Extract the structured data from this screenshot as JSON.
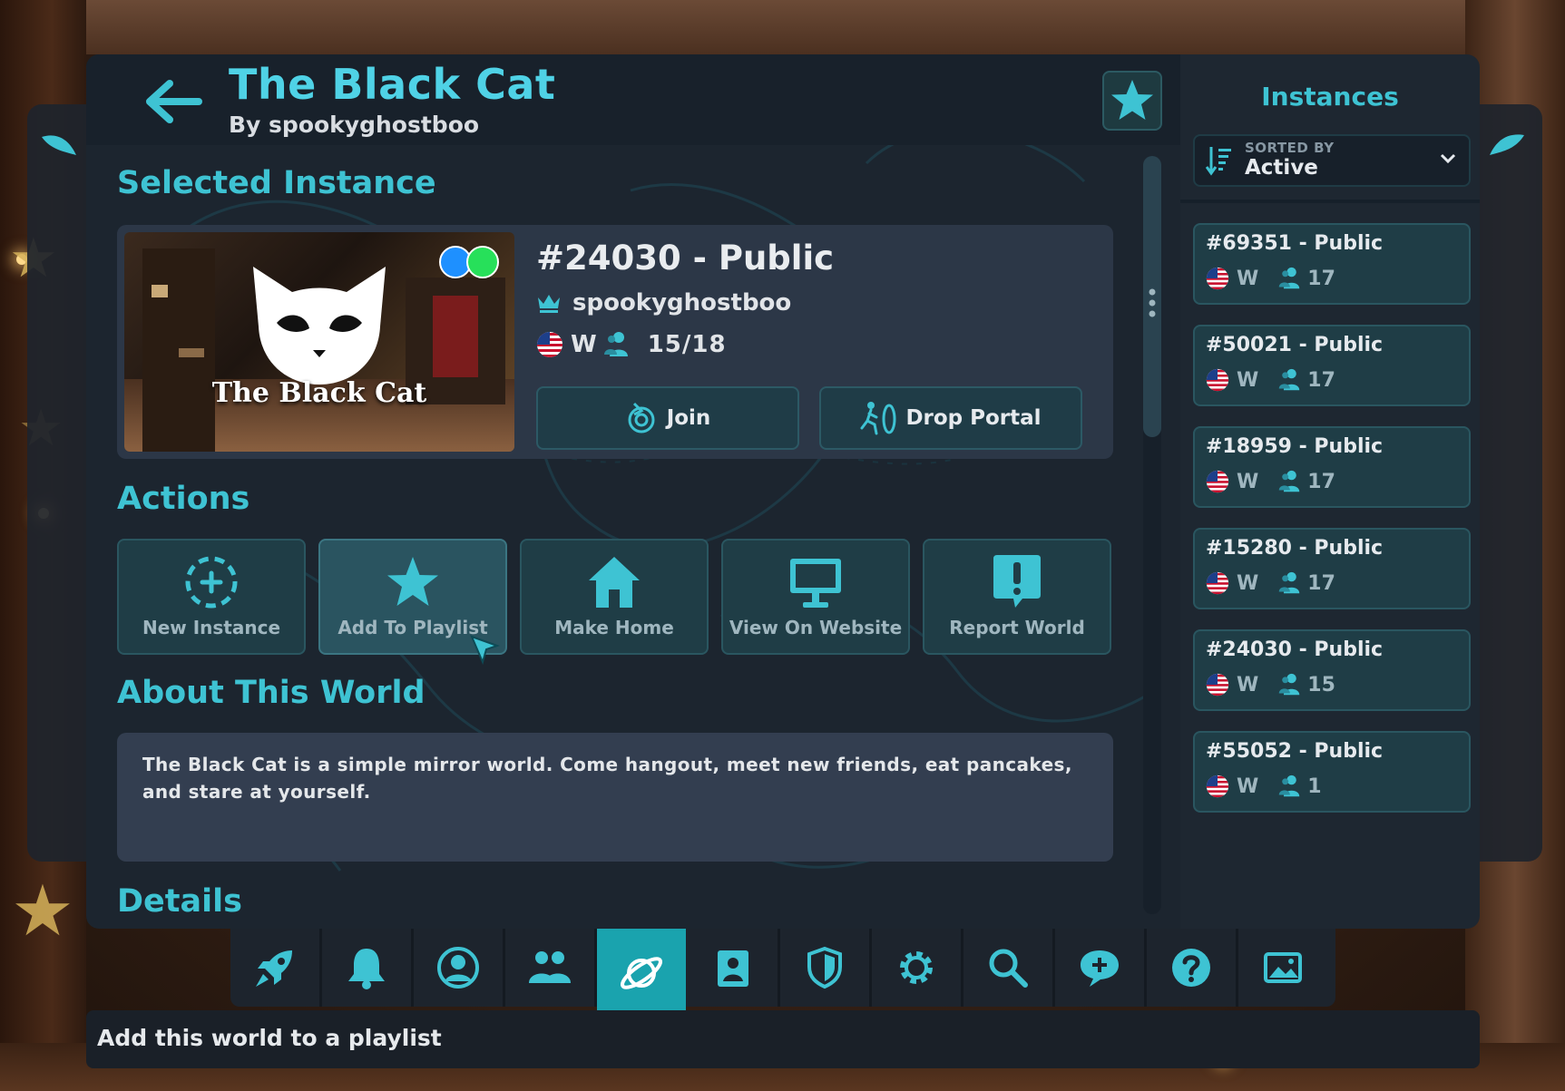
{
  "world": {
    "title": "The Black Cat",
    "byline": "By spookyghostboo",
    "thumbnail_caption": "The Black Cat"
  },
  "selected_instance": {
    "section_title": "Selected Instance",
    "title": "#24030 - Public",
    "owner": "spookyghostboo",
    "region": "W",
    "occupancy": "15/18",
    "join_label": "Join",
    "drop_portal_label": "Drop Portal"
  },
  "actions": {
    "section_title": "Actions",
    "items": [
      {
        "label": "New Instance",
        "icon": "new-instance-icon"
      },
      {
        "label": "Add To Playlist",
        "icon": "star-icon"
      },
      {
        "label": "Make Home",
        "icon": "home-icon"
      },
      {
        "label": "View On Website",
        "icon": "monitor-icon"
      },
      {
        "label": "Report World",
        "icon": "report-icon"
      }
    ]
  },
  "about": {
    "section_title": "About This World",
    "description": "The Black Cat is a simple mirror world. Come hangout, meet new friends, eat pancakes, and stare at yourself."
  },
  "details": {
    "section_title": "Details"
  },
  "instances_panel": {
    "title": "Instances",
    "sort_caption": "SORTED BY",
    "sort_value": "Active",
    "items": [
      {
        "title": "#69351 - Public",
        "region": "W",
        "count": "17"
      },
      {
        "title": "#50021 - Public",
        "region": "W",
        "count": "17"
      },
      {
        "title": "#18959 - Public",
        "region": "W",
        "count": "17"
      },
      {
        "title": "#15280 - Public",
        "region": "W",
        "count": "17"
      },
      {
        "title": "#24030 - Public",
        "region": "W",
        "count": "15"
      },
      {
        "title": "#55052 - Public",
        "region": "W",
        "count": "1"
      }
    ]
  },
  "navbar": {
    "items": [
      "rocket-icon",
      "bell-icon",
      "profile-icon",
      "friends-icon",
      "worlds-icon",
      "avatar-icon",
      "safety-icon",
      "settings-icon",
      "search-icon",
      "chat-icon",
      "help-icon",
      "gallery-icon"
    ],
    "active": "worlds-icon"
  },
  "tooltip": {
    "text": "Add this world to a playlist"
  },
  "colors": {
    "accent": "#3ec3d3",
    "title": "#4fd2e6",
    "button_bg": "#1f3d46",
    "nav_active": "#1aa3ae"
  }
}
